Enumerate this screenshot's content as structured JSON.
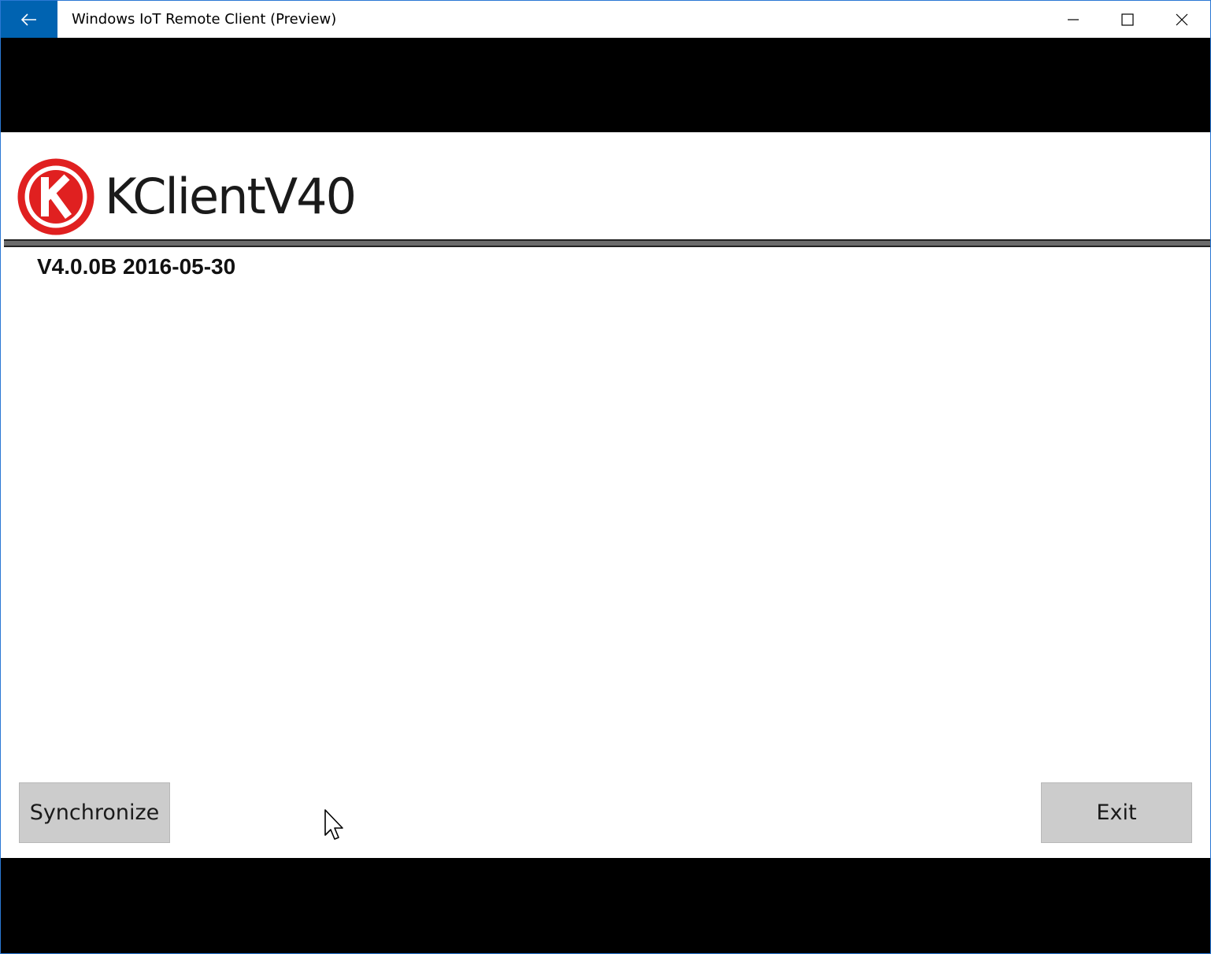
{
  "window": {
    "title": "Windows IoT Remote Client (Preview)",
    "accent_color": "#0063b1",
    "controls": {
      "back_icon": "arrow-left-icon",
      "minimize_icon": "minimize-icon",
      "maximize_icon": "maximize-icon",
      "close_icon": "close-icon"
    }
  },
  "app": {
    "logo_icon": "k-logo-icon",
    "logo_color": "#e02020",
    "brand_name": "KClientV40",
    "version": "V4.0.0B 2016-05-30"
  },
  "actions": {
    "synchronize_label": "Synchronize",
    "exit_label": "Exit"
  }
}
